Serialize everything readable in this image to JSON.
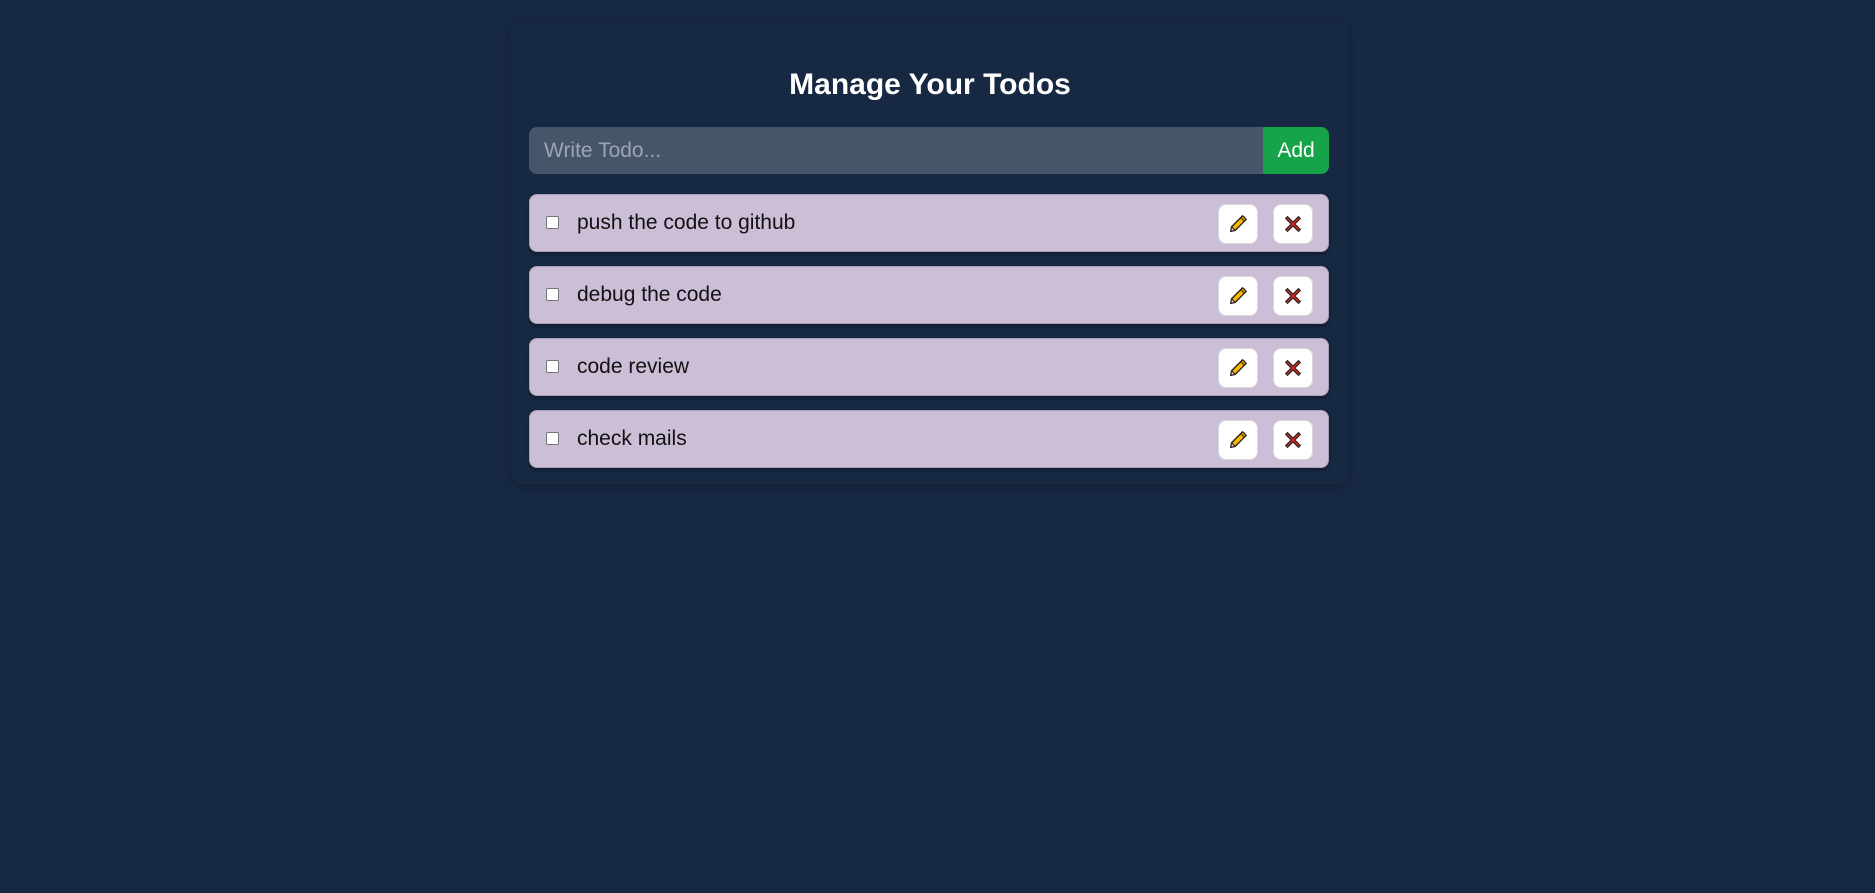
{
  "header": {
    "title": "Manage Your Todos"
  },
  "form": {
    "placeholder": "Write Todo...",
    "value": "",
    "add_label": "Add"
  },
  "todos": [
    {
      "text": "push the code to github",
      "completed": false
    },
    {
      "text": "debug the code",
      "completed": false
    },
    {
      "text": "code review",
      "completed": false
    },
    {
      "text": "check mails",
      "completed": false
    }
  ],
  "icons": {
    "edit": "pencil-icon",
    "delete": "cross-mark-icon"
  },
  "colors": {
    "background": "#172842",
    "input_bg": "#465569",
    "add_button": "#16a34a",
    "todo_bg": "#ccbed7"
  }
}
